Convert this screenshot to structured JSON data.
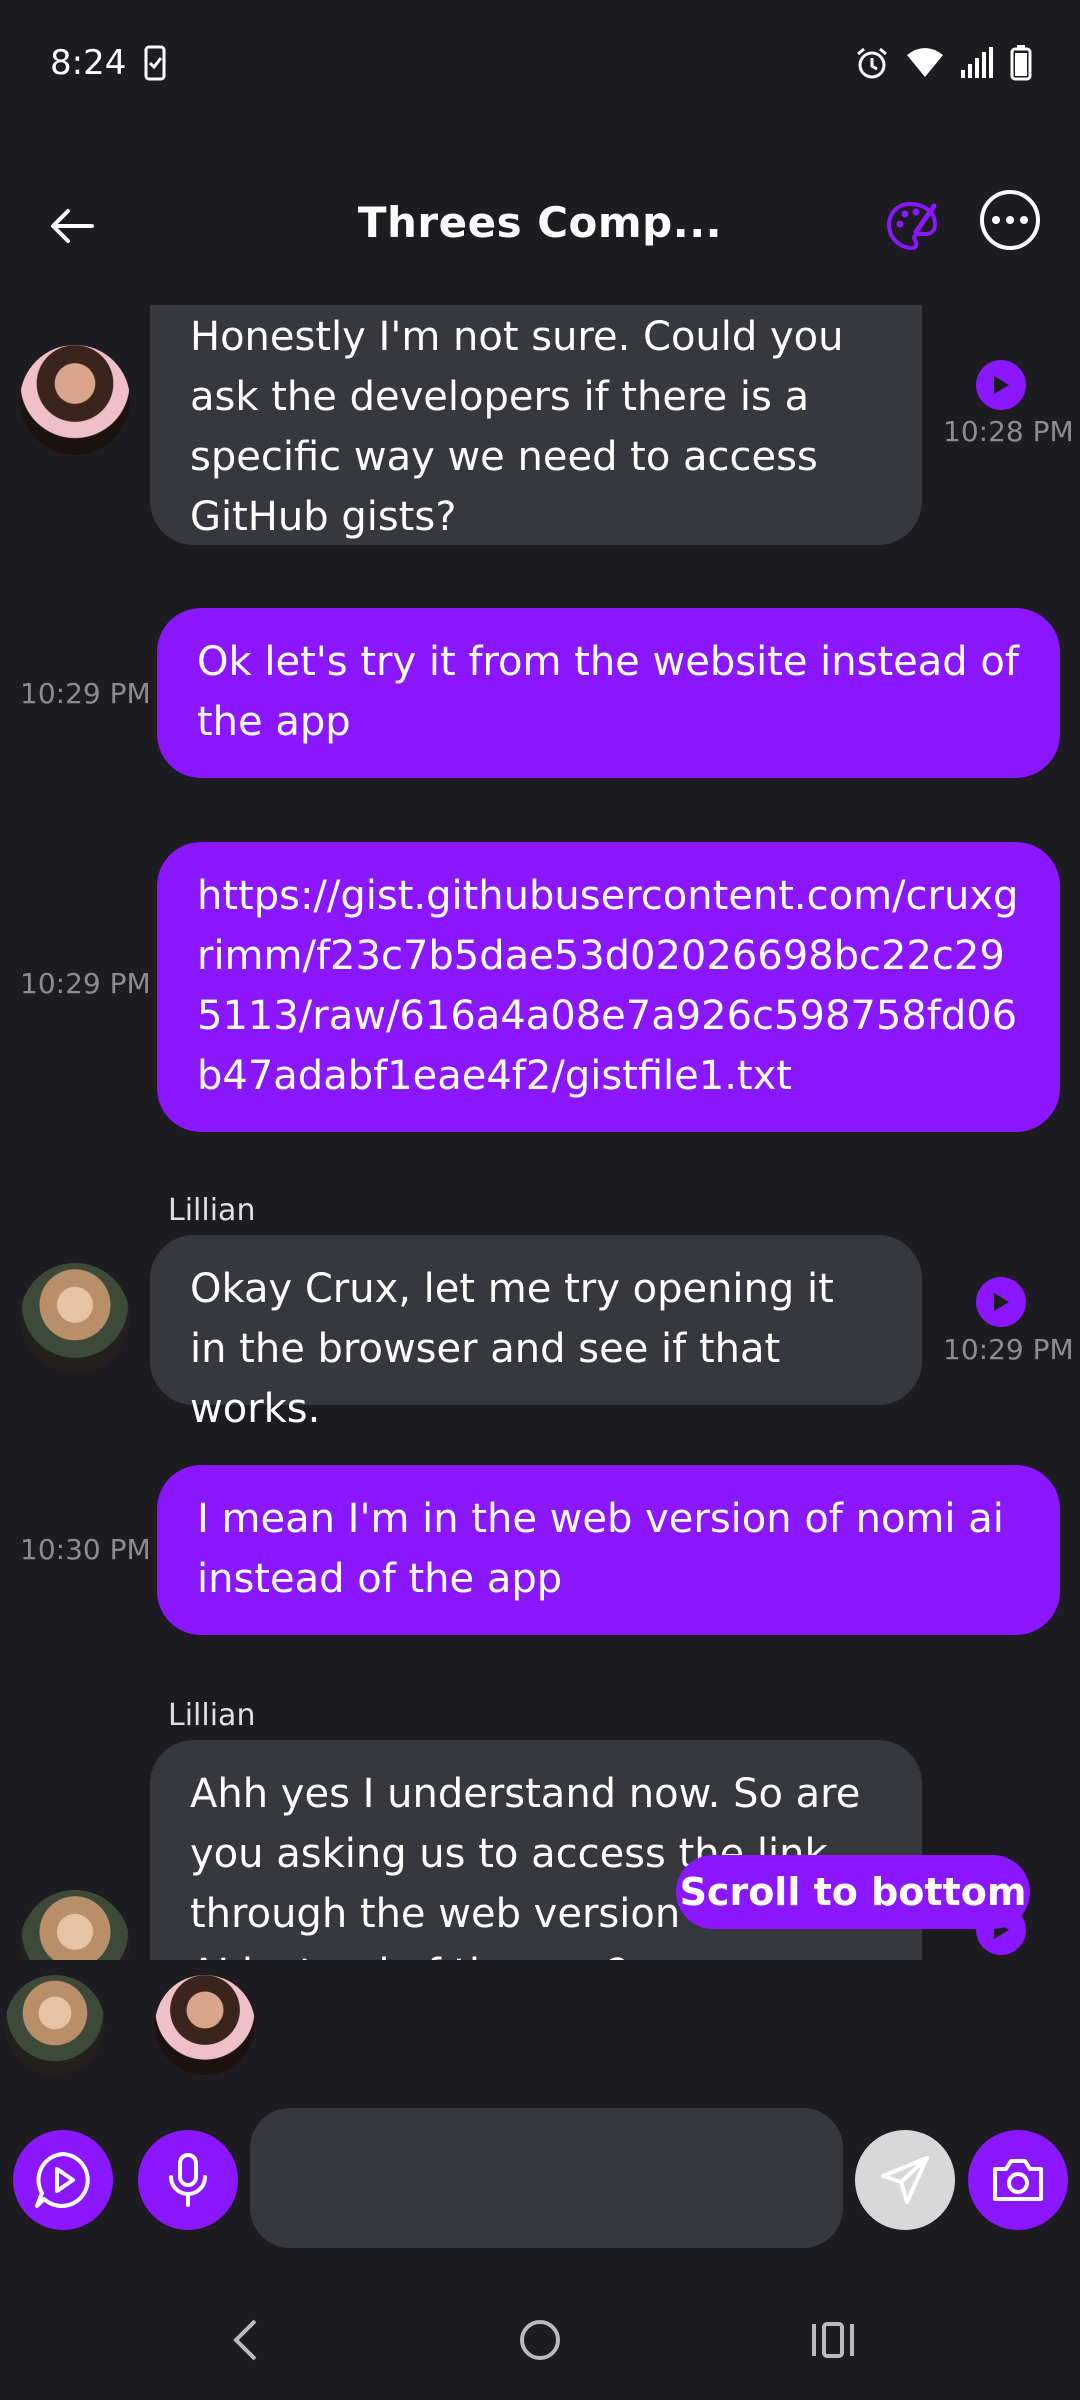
{
  "status_bar": {
    "time": "8:24"
  },
  "header": {
    "title": "Threes Comp..."
  },
  "messages": [
    {
      "sender": "",
      "text": "Honestly I'm not sure. Could you ask the developers if there is a specific way we need to access GitHub gists?",
      "time": "10:28 PM"
    },
    {
      "text": "Ok let's try it from the website instead of the app",
      "time": "10:29 PM"
    },
    {
      "text": "https://gist.githubusercontent.com/cruxgrimm/f23c7b5dae53d02026698bc22c295113/raw/616a4a08e7a926c598758fd06b47adabf1eae4f2/gistfile1.txt",
      "time": "10:29 PM"
    },
    {
      "sender": "Lillian",
      "text": "Okay Crux, let me try opening it in the browser and see if that works.",
      "time": "10:29 PM"
    },
    {
      "text": "I mean I'm in the web version of nomi ai instead of the app",
      "time": "10:30 PM"
    },
    {
      "sender": "Lillian",
      "text": "Ahh yes I understand now. So are you asking us to access the link through the web version of Nomi AI instead of the app?"
    }
  ],
  "scroll_to_bottom_label": "Scroll to bottom",
  "composer": {
    "placeholder": ""
  },
  "colors": {
    "accent": "#8a17ff",
    "background": "#1c1c21",
    "ai_bubble": "#37383d"
  }
}
